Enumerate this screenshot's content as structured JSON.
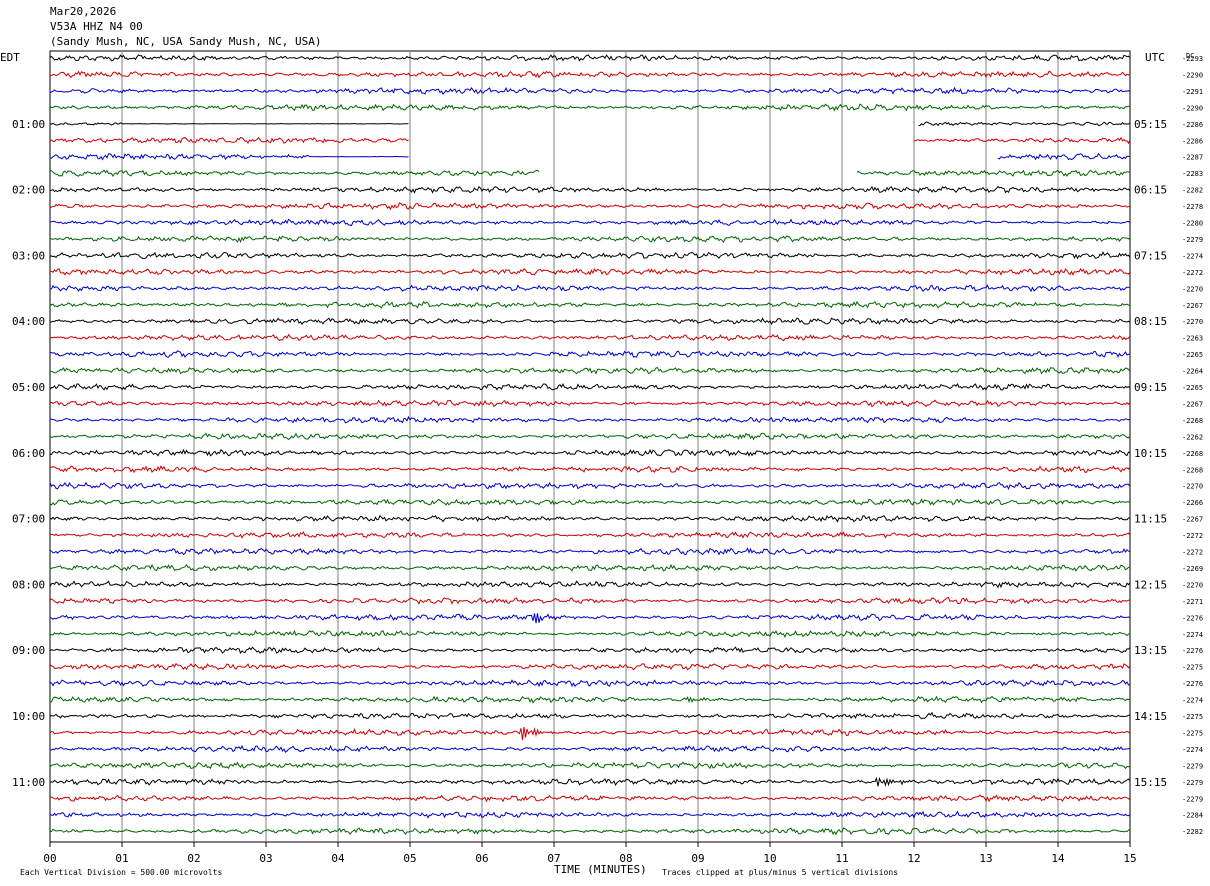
{
  "header": {
    "date": "Mar20,2026",
    "station": "V53A HHZ N4 00",
    "location": "(Sandy Mush, NC, USA Sandy Mush, NC, USA)"
  },
  "left_axis_title": "EDT",
  "right_axis_title": "UTC",
  "dc_label": "DC",
  "footer": {
    "scale_note": "Each Vertical Division =  500.00 microvolts",
    "clip_note": "Traces clipped at plus/minus 5 vertical divisions",
    "xlabel": "TIME (MINUTES)"
  },
  "colors": {
    "trace_cycle": [
      "#000000",
      "#cc0000",
      "#0000cc",
      "#006600"
    ],
    "grid": "#808080"
  },
  "chart_data": {
    "type": "line",
    "title": "V53A HHZ N4 00",
    "xlabel": "TIME (MINUTES)",
    "xlim": [
      0,
      15
    ],
    "x_ticks": [
      "00",
      "01",
      "02",
      "03",
      "04",
      "05",
      "06",
      "07",
      "08",
      "09",
      "10",
      "11",
      "12",
      "13",
      "14",
      "15"
    ],
    "grid": true,
    "n_traces": 48,
    "minutes_per_trace": 15,
    "left_time_labels": [
      "01:00",
      "02:00",
      "03:00",
      "04:00",
      "05:00",
      "06:00",
      "07:00",
      "08:00",
      "09:00",
      "10:00",
      "11:00"
    ],
    "right_time_labels": [
      "05:15",
      "06:15",
      "07:15",
      "08:15",
      "09:15",
      "10:15",
      "11:15",
      "12:15",
      "13:15",
      "14:15",
      "15:15"
    ],
    "dc_offsets": [
      "-2293",
      "-2290",
      "-2291",
      "-2290",
      "-2286",
      "-2286",
      "-2287",
      "-2283",
      "-2282",
      "-2278",
      "-2280",
      "-2279",
      "-2274",
      "-2272",
      "-2270",
      "-2267",
      "-2270",
      "-2263",
      "-2265",
      "-2264",
      "-2265",
      "-2267",
      "-2268",
      "-2262",
      "-2268",
      "-2268",
      "-2270",
      "-2266",
      "-2267",
      "-2272",
      "-2272",
      "-2269",
      "-2270",
      "-2271",
      "-2276",
      "-2274",
      "-2276",
      "-2275",
      "-2276",
      "-2274",
      "-2275",
      "-2275",
      "-2274",
      "-2279",
      "-2279",
      "-2279",
      "-2284",
      "-2282"
    ],
    "gaps": [
      {
        "trace": 4,
        "from_min": 5.0,
        "to_min": 12.05,
        "flat_from_min": 1.0
      },
      {
        "trace": 5,
        "from_min": 5.0,
        "to_min": 12.0
      },
      {
        "trace": 6,
        "from_min": 5.0,
        "to_min": 13.15,
        "flat_from_min": 3.6
      },
      {
        "trace": 7,
        "from_min": 6.8,
        "to_min": 11.2
      }
    ],
    "events": [
      {
        "trace": 34,
        "minute": 6.7,
        "amplitude": 1.0
      },
      {
        "trace": 39,
        "minute": 8.8,
        "amplitude": 0.35
      },
      {
        "trace": 41,
        "minute": 6.55,
        "amplitude": 1.2
      },
      {
        "trace": 44,
        "minute": 11.5,
        "amplitude": 1.2
      }
    ]
  }
}
